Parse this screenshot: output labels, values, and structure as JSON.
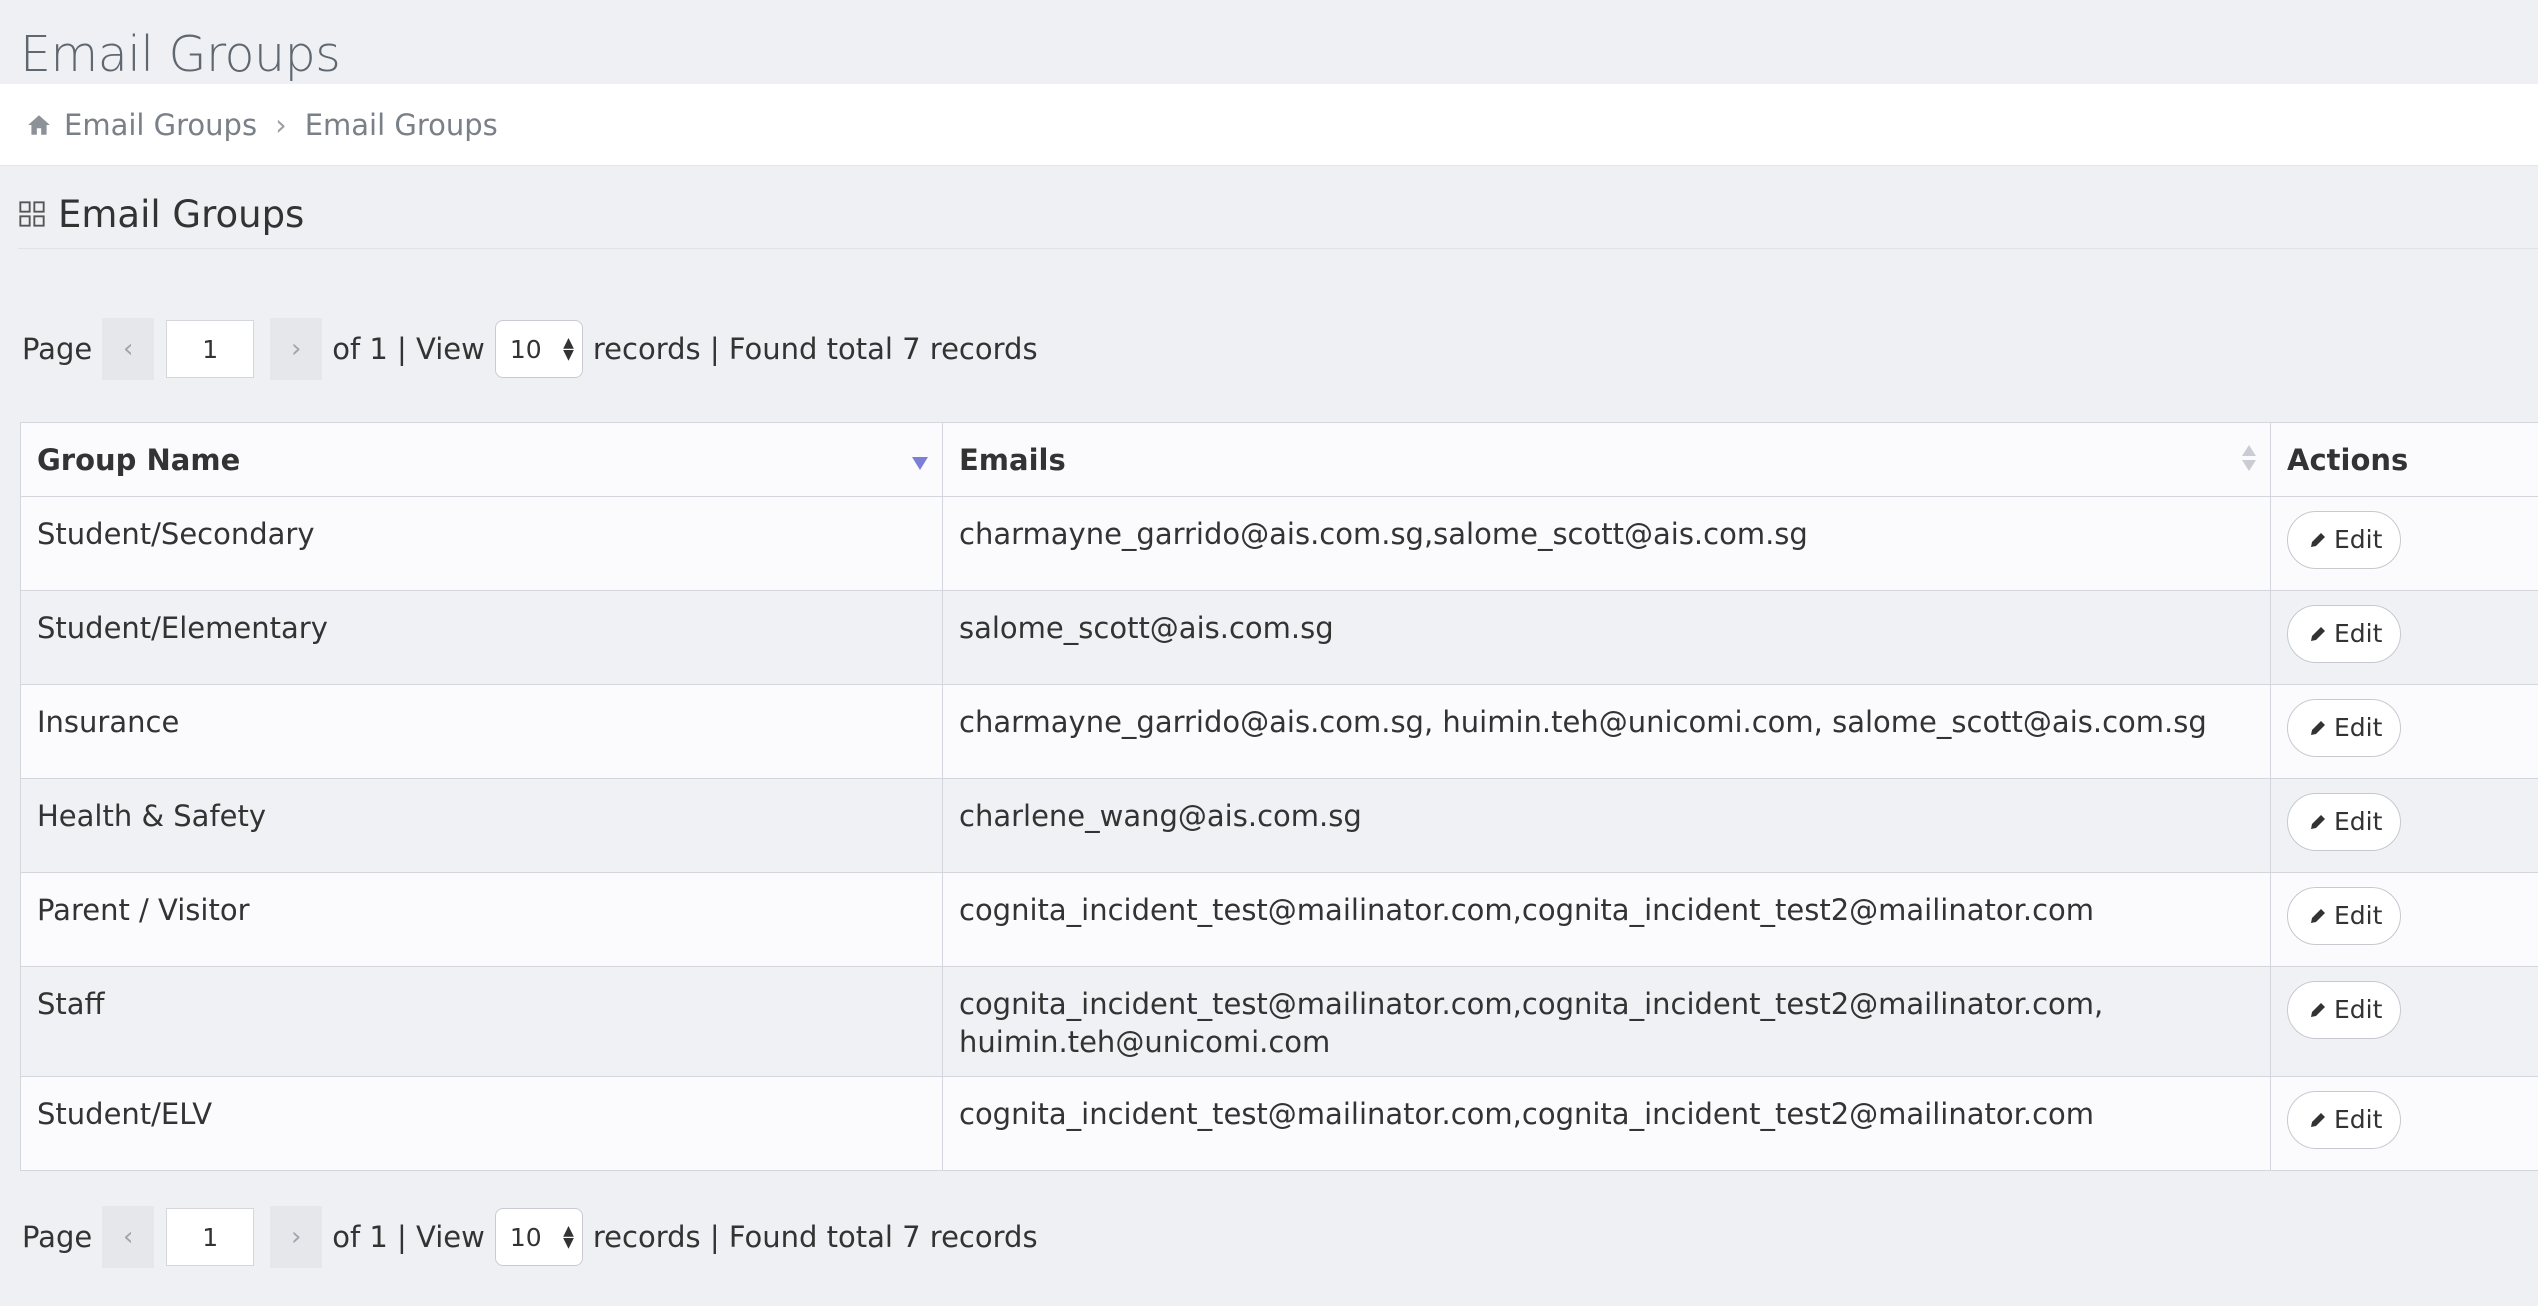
{
  "page": {
    "title": "Email Groups"
  },
  "breadcrumb": {
    "items": [
      "Email Groups",
      "Email Groups"
    ]
  },
  "panel": {
    "title": "Email Groups"
  },
  "pager": {
    "page_label": "Page",
    "prev_glyph": "‹",
    "next_glyph": "›",
    "current_page": "1",
    "of_text": "of 1 | View",
    "view_value": "10",
    "records_text": "records | Found total 7 records"
  },
  "table": {
    "headers": {
      "group_name": "Group Name",
      "emails": "Emails",
      "actions": "Actions"
    },
    "edit_label": "Edit",
    "rows": [
      {
        "group_name": "Student/Secondary",
        "emails": "charmayne_garrido@ais.com.sg,salome_scott@ais.com.sg"
      },
      {
        "group_name": "Student/Elementary",
        "emails": "salome_scott@ais.com.sg"
      },
      {
        "group_name": "Insurance",
        "emails": "charmayne_garrido@ais.com.sg, huimin.teh@unicomi.com, salome_scott@ais.com.sg"
      },
      {
        "group_name": "Health & Safety",
        "emails": "charlene_wang@ais.com.sg"
      },
      {
        "group_name": "Parent / Visitor",
        "emails": "cognita_incident_test@mailinator.com,cognita_incident_test2@mailinator.com"
      },
      {
        "group_name": "Staff",
        "emails": "cognita_incident_test@mailinator.com,cognita_incident_test2@mailinator.com, huimin.teh@unicomi.com"
      },
      {
        "group_name": "Student/ELV",
        "emails": "cognita_incident_test@mailinator.com,cognita_incident_test2@mailinator.com"
      }
    ]
  },
  "colors": {
    "page_bg": "#eff0f4",
    "sort_active": "#7b7fd6"
  }
}
